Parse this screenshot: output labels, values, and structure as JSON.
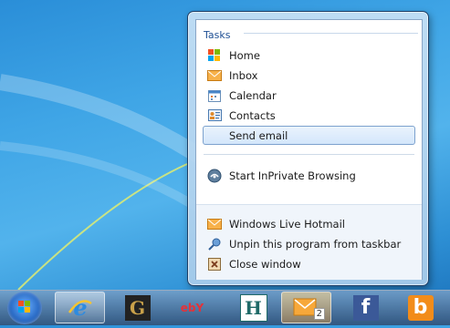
{
  "jumplist": {
    "section_title": "Tasks",
    "tasks": [
      {
        "label": "Home",
        "icon": "windows-flag-icon"
      },
      {
        "label": "Inbox",
        "icon": "envelope-icon"
      },
      {
        "label": "Calendar",
        "icon": "calendar-icon"
      },
      {
        "label": "Contacts",
        "icon": "contacts-card-icon"
      },
      {
        "label": "Send email",
        "icon": "",
        "selected": true
      }
    ],
    "inprivate": {
      "label": "Start InPrivate Browsing",
      "icon": "inprivate-icon"
    },
    "footer": [
      {
        "label": "Windows Live Hotmail",
        "icon": "envelope-icon"
      },
      {
        "label": "Unpin this program from taskbar",
        "icon": "unpin-icon"
      },
      {
        "label": "Close window",
        "icon": "close-window-icon"
      }
    ]
  },
  "taskbar": {
    "items": [
      {
        "name": "internet-explorer",
        "icon": "internet-explorer-icon",
        "active": true
      },
      {
        "name": "g-site",
        "icon": "g-tile-icon",
        "text": "G"
      },
      {
        "name": "ebay",
        "icon": "ebay-icon",
        "text": "ebY"
      },
      {
        "name": "h-site",
        "icon": "h-tile-icon",
        "text": "H"
      },
      {
        "name": "hotmail",
        "icon": "hotmail-envelope-icon",
        "badge": "2"
      },
      {
        "name": "facebook",
        "icon": "facebook-icon",
        "text": "f"
      },
      {
        "name": "bing",
        "icon": "bing-icon",
        "text": "b"
      }
    ]
  },
  "colors": {
    "section_title": "#1e4f94",
    "selected_bg": "#d3e6fb",
    "taskbar": "#32557d"
  }
}
